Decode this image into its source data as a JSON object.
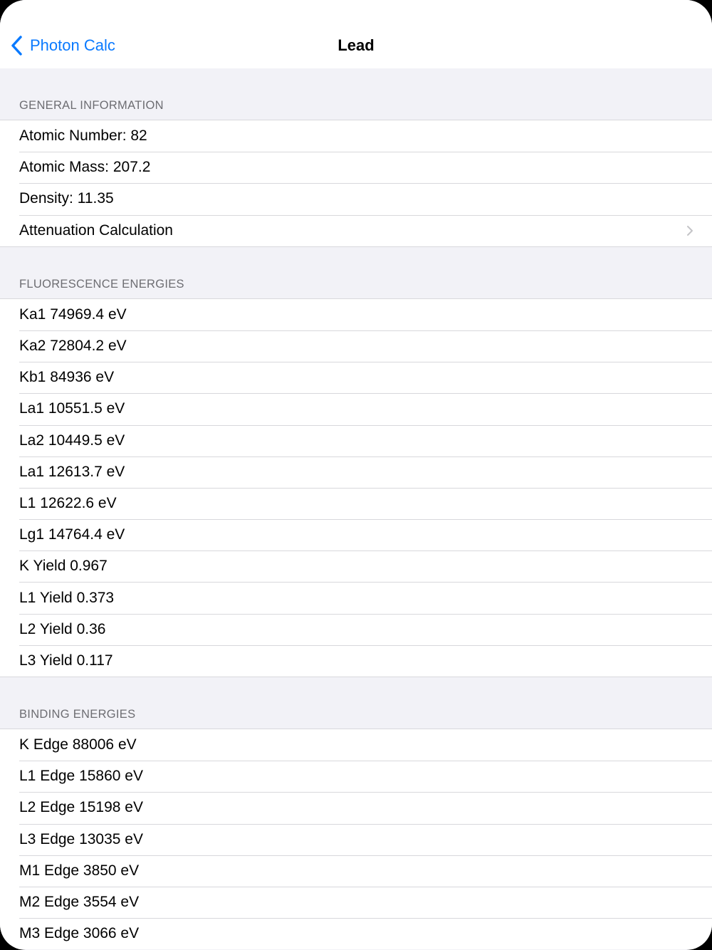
{
  "nav": {
    "back_label": "Photon Calc",
    "title": "Lead"
  },
  "sections": {
    "general": {
      "header": "GENERAL INFORMATION",
      "rows": [
        "Atomic Number: 82",
        "Atomic Mass: 207.2",
        "Density: 11.35"
      ],
      "link_label": "Attenuation Calculation"
    },
    "fluorescence": {
      "header": "FLUORESCENCE ENERGIES",
      "rows": [
        "Ka1 74969.4 eV",
        "Ka2 72804.2 eV",
        "Kb1 84936 eV",
        "La1 10551.5 eV",
        "La2 10449.5 eV",
        "La1 12613.7 eV",
        "L1 12622.6 eV",
        "Lg1 14764.4 eV",
        "K Yield 0.967",
        "L1 Yield 0.373",
        "L2 Yield 0.36",
        "L3 Yield 0.117"
      ]
    },
    "binding": {
      "header": "BINDING ENERGIES",
      "rows": [
        "K Edge 88006 eV",
        "L1 Edge 15860 eV",
        "L2 Edge 15198 eV",
        "L3 Edge 13035 eV",
        "M1 Edge 3850 eV",
        "M2 Edge 3554 eV",
        "M3 Edge 3066 eV"
      ]
    }
  },
  "colors": {
    "accent": "#0a7aff",
    "background": "#f2f2f7",
    "separator": "#d8d8dc"
  }
}
